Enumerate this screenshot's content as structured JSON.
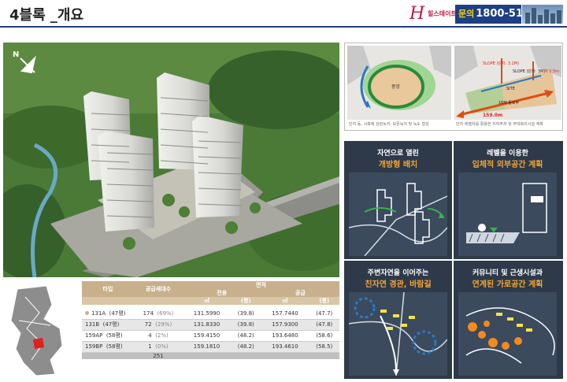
{
  "header": {
    "title": "4블록 _개요",
    "logo_text": "힐스테이트",
    "phone_label": "문의",
    "phone_number": "1800-5125"
  },
  "aerial": {
    "north_label": "N"
  },
  "diagrams": {
    "left_labels": {
      "ring_text": "중앙"
    },
    "left_caption": "단지 등, 시축에 강관녹지, 보존녹지 및 녹도 형성",
    "right_labels": {
      "slope1": "SLOPE (단차: 3.2M)",
      "slope2": "SLOPE (단차: 3M)",
      "site": "SITE",
      "width": "16M 동로부",
      "length": "159.0m",
      "height": "약 5.5m"
    },
    "right_caption": "단지 레벨차를 활용한 지하주차 및 부대복리시설 계획"
  },
  "concepts": [
    {
      "line1": "자연으로 열린",
      "line2": "개방형 배치"
    },
    {
      "line1": "레벨을 이용한",
      "line2": "입체적 외부공간 계획"
    },
    {
      "line1": "주변자연을 이어주는",
      "line2": "친자연 경관, 바람길"
    },
    {
      "line1": "커뮤니티 및 근생시설과",
      "line2": "연계된 가로공간 계획"
    }
  ],
  "table": {
    "header": {
      "type": "타입",
      "supply": "공급세대수",
      "area": "면적",
      "exclusive": "전용",
      "supply_area": "공급",
      "sqm": "㎡",
      "pyeong": "(평)"
    },
    "rows": [
      {
        "type": "131A",
        "py": "(47평)",
        "units": "174",
        "pct": "(69%)",
        "ex_m2": "131.5990",
        "ex_py": "(39.8)",
        "sup_m2": "157.7440",
        "sup_py": "(47.7)"
      },
      {
        "type": "131B",
        "py": "(47평)",
        "units": "72",
        "pct": "(29%)",
        "ex_m2": "131.8330",
        "ex_py": "(39.8)",
        "sup_m2": "157.9300",
        "sup_py": "(47.8)"
      },
      {
        "type": "159AP",
        "py": "(58평)",
        "units": "4",
        "pct": "(2%)",
        "ex_m2": "159.4150",
        "ex_py": "(48.2)",
        "sup_m2": "193.6480",
        "sup_py": "(58.6)"
      },
      {
        "type": "159BP",
        "py": "(58평)",
        "units": "1",
        "pct": "(0%)",
        "ex_m2": "159.1810",
        "ex_py": "(48.2)",
        "sup_m2": "193.4610",
        "sup_py": "(58.5)"
      }
    ],
    "total_units": "251"
  },
  "colors": {
    "brand_navy": "#1f3f85",
    "accent_orange": "#f4a434",
    "table_tan": "#c8b08c",
    "logo_red": "#c0173d"
  }
}
